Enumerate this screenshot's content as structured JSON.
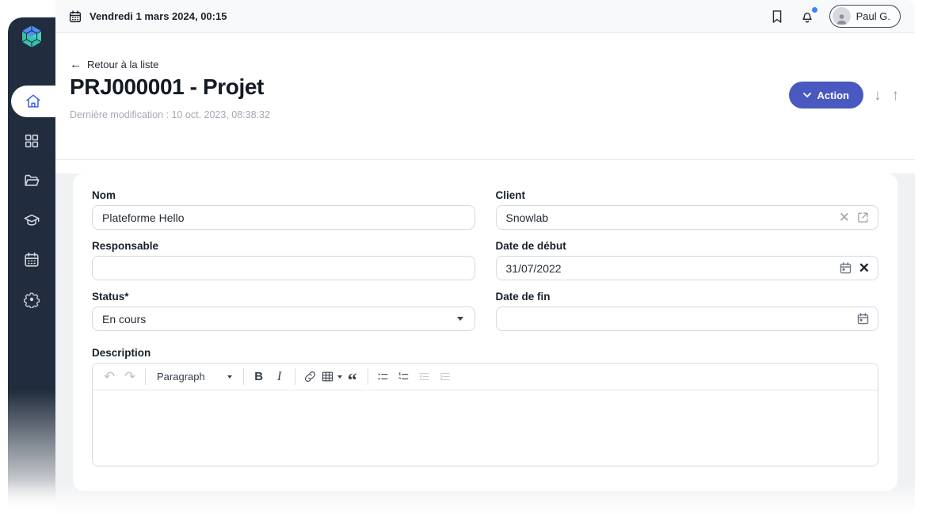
{
  "topbar": {
    "date": "Vendredi 1 mars 2024, 00:15",
    "user_name": "Paul G."
  },
  "header": {
    "back_label": "Retour à la liste",
    "title": "PRJ000001 - Projet",
    "subtitle": "Dernière modification : 10 oct. 2023, 08:38:32",
    "action_label": "Action"
  },
  "form": {
    "nom": {
      "label": "Nom",
      "value": "Plateforme Hello"
    },
    "client": {
      "label": "Client",
      "value": "Snowlab"
    },
    "responsable": {
      "label": "Responsable",
      "value": ""
    },
    "date_debut": {
      "label": "Date de début",
      "value": "31/07/2022"
    },
    "status": {
      "label": "Status*",
      "value": "En cours"
    },
    "date_fin": {
      "label": "Date de fin",
      "value": ""
    },
    "description": {
      "label": "Description",
      "value": ""
    }
  },
  "editor": {
    "paragraph_label": "Paragraph",
    "bold_label": "B",
    "italic_label": "I"
  },
  "icons": {
    "back_arrow": "←",
    "down_arrow": "↓",
    "up_arrow": "↑",
    "clear_x": "✕",
    "undo": "↶",
    "redo": "↷",
    "quote": "“"
  },
  "sidebar": {
    "active_item": "home",
    "items": [
      "home",
      "apps-grid",
      "folder",
      "education",
      "calendar",
      "settings"
    ]
  },
  "colors": {
    "accent": "#4a59c0",
    "sidebar_bg": "#212d3e",
    "notification_dot": "#3b82f6",
    "content_bg": "#eff1f3"
  }
}
